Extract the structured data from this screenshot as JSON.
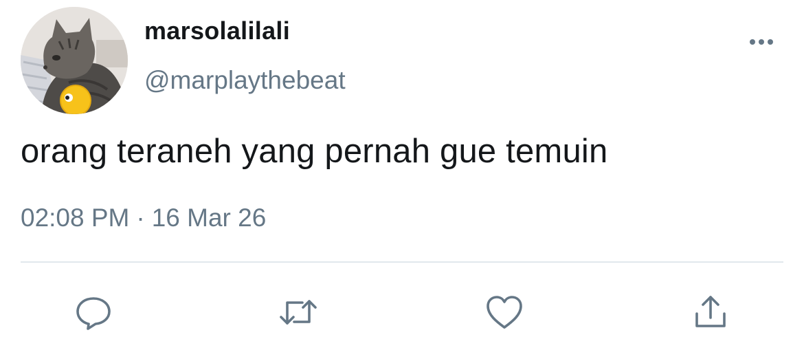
{
  "user": {
    "display_name": "marsolalilali",
    "handle": "@marplaythebeat",
    "avatar_icon": "cat-avatar"
  },
  "tweet": {
    "text": "orang teraneh yang pernah gue temuin",
    "time": "02:08 PM",
    "separator": "·",
    "date": "16 Mar 26"
  },
  "actions": [
    {
      "icon": "reply-icon"
    },
    {
      "icon": "retweet-icon"
    },
    {
      "icon": "like-icon"
    },
    {
      "icon": "share-icon"
    }
  ],
  "colors": {
    "text_primary": "#14171a",
    "text_secondary": "#657786",
    "divider": "#e1e8ed",
    "icon": "#657786"
  }
}
